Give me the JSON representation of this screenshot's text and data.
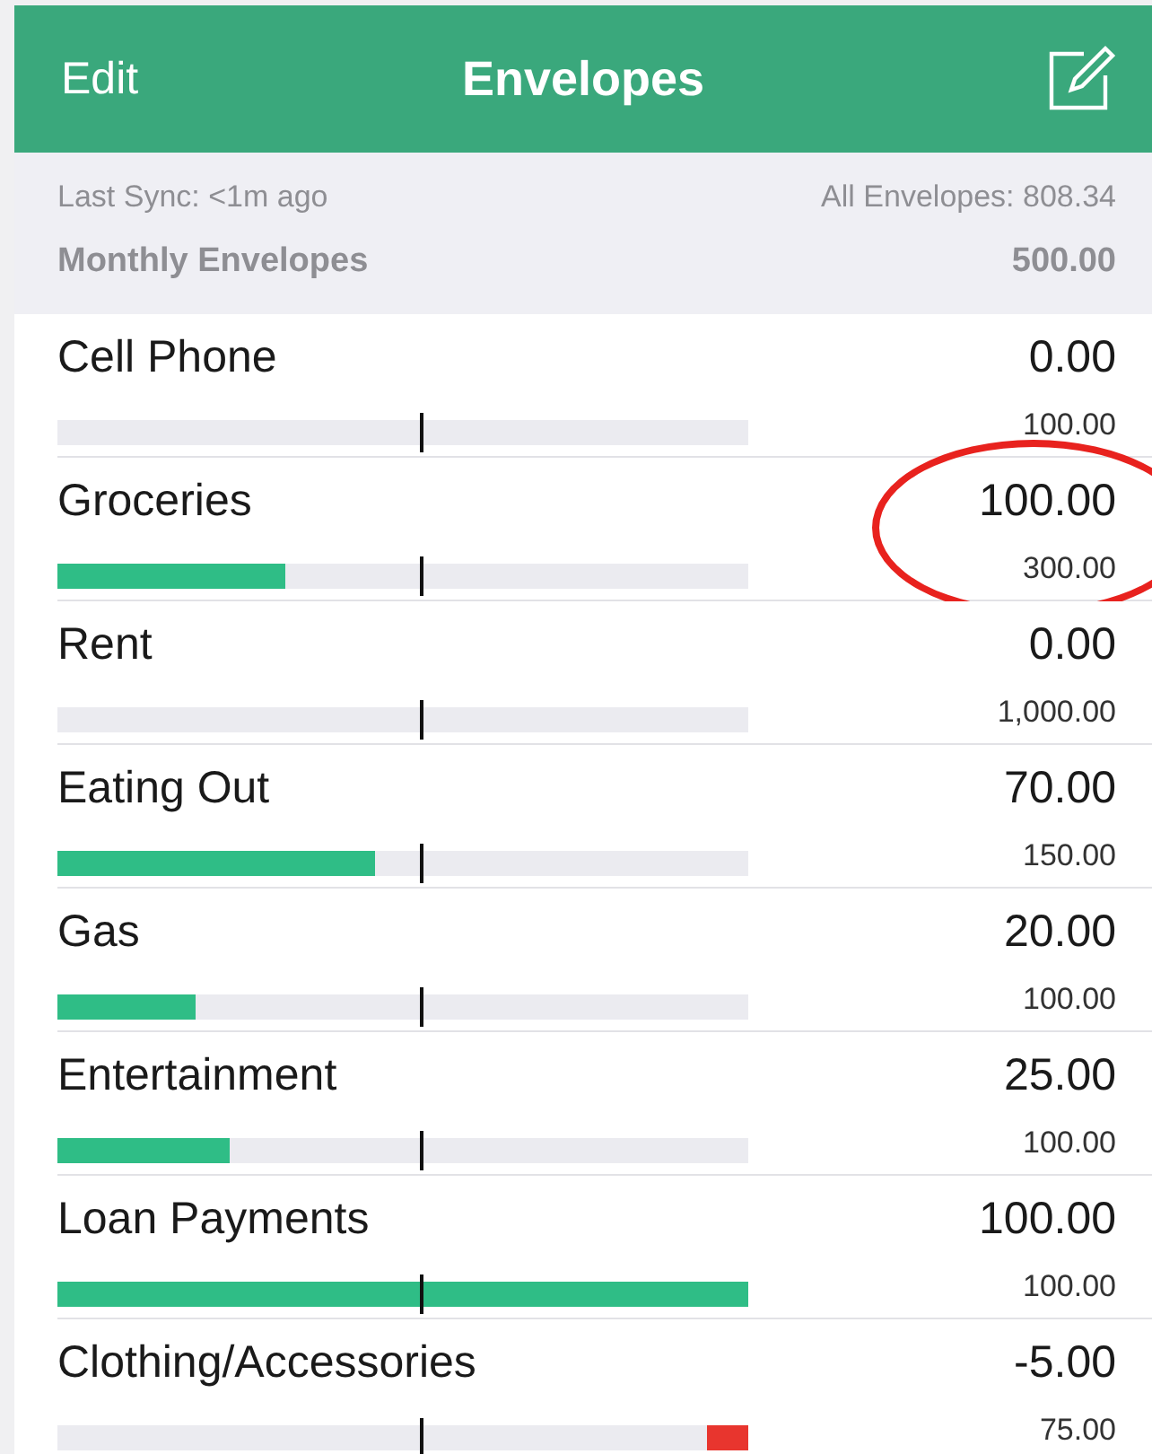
{
  "nav_bar": {
    "left_button": "Edit",
    "title": "Envelopes"
  },
  "sync_bar": {
    "last_sync": "Last Sync: <1m ago",
    "all_envelopes": "All Envelopes: 808.34"
  },
  "section": {
    "title": "Monthly Envelopes",
    "total": "500.00"
  },
  "envelopes": [
    {
      "name": "Cell Phone",
      "amount": "0.00",
      "budget": "100.00",
      "level": 0,
      "circled": false
    },
    {
      "name": "Groceries",
      "amount": "100.00",
      "budget": "300.00",
      "level": 0.33,
      "overspent": false,
      "circled": true
    },
    {
      "name": "Rent",
      "amount": "0.00",
      "budget": "1,000.00",
      "level": 0,
      "circled": false
    },
    {
      "name": "Eating Out",
      "amount": "70.00",
      "budget": "150.00",
      "level": 0.46,
      "overspent": false,
      "circled": false
    },
    {
      "name": "Gas",
      "amount": "20.00",
      "budget": "100.00",
      "level": 0.2,
      "overspent": false,
      "circled": false
    },
    {
      "name": "Entertainment",
      "amount": "25.00",
      "budget": "100.00",
      "level": 0.25,
      "overspent": false,
      "circled": false
    },
    {
      "name": "Loan Payments",
      "amount": "100.00",
      "budget": "100.00",
      "level": 1,
      "overspent": false,
      "circled": false
    },
    {
      "name": "Clothing/Accessories",
      "amount": "-5.00",
      "budget": "75.00",
      "level": 0.06,
      "overspent": true,
      "circled": false
    }
  ]
}
